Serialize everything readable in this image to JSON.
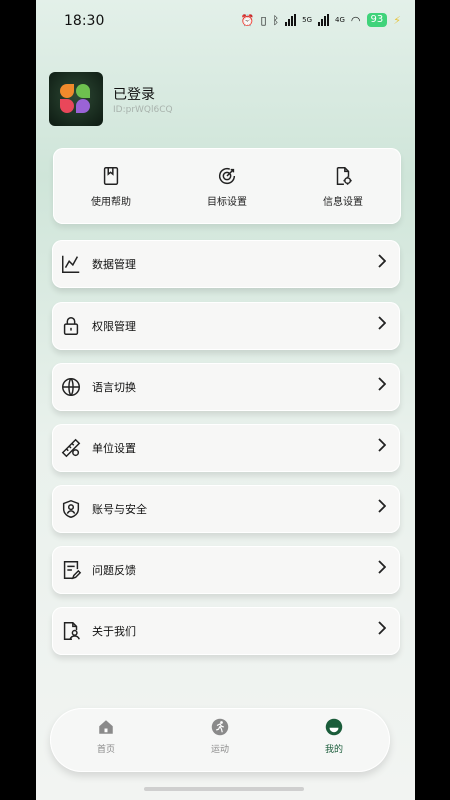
{
  "status_bar": {
    "time": "18:30",
    "network_label": "5G",
    "lte_label": "4G",
    "battery": "93"
  },
  "profile": {
    "name": "已登录",
    "id_text": "ID:prWQl6CQ"
  },
  "quick_actions": [
    {
      "label": "使用帮助",
      "icon": "book-icon"
    },
    {
      "label": "目标设置",
      "icon": "target-icon"
    },
    {
      "label": "信息设置",
      "icon": "file-settings-icon"
    }
  ],
  "menu": [
    {
      "label": "数据管理",
      "icon": "chart-icon"
    },
    {
      "label": "权限管理",
      "icon": "lock-icon"
    },
    {
      "label": "语言切换",
      "icon": "globe-icon"
    },
    {
      "label": "单位设置",
      "icon": "ruler-icon"
    },
    {
      "label": "账号与安全",
      "icon": "shield-user-icon"
    },
    {
      "label": "问题反馈",
      "icon": "feedback-icon"
    },
    {
      "label": "关于我们",
      "icon": "about-icon"
    }
  ],
  "tabbar": {
    "items": [
      {
        "label": "首页",
        "icon": "home-icon",
        "active": false
      },
      {
        "label": "运动",
        "icon": "run-icon",
        "active": false
      },
      {
        "label": "我的",
        "icon": "profile-icon",
        "active": true
      }
    ]
  },
  "colors": {
    "accent": "#1a5c3a",
    "battery": "#3fd37a",
    "card": "#f7f7f6"
  }
}
